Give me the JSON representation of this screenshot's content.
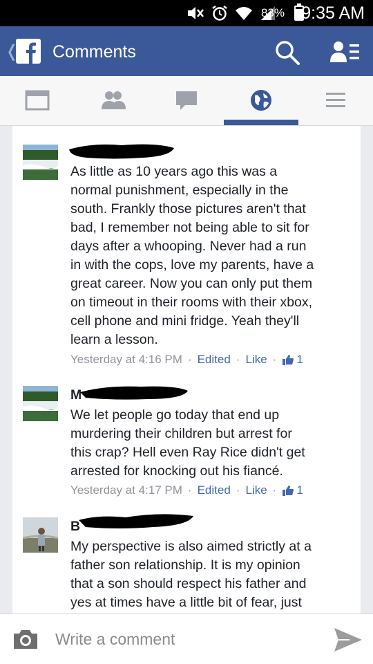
{
  "status_bar": {
    "battery_percent_label": "83%",
    "battery_level": 0.83,
    "time": "9:35 AM",
    "icons": [
      "mute-icon",
      "alarm-icon",
      "wifi-icon",
      "signal-icon",
      "battery-icon"
    ]
  },
  "app_bar": {
    "title": "Comments",
    "icons": [
      "back-chevron-icon",
      "facebook-logo-icon",
      "search-icon",
      "friends-icon"
    ]
  },
  "tabs": [
    {
      "name": "news-feed-icon",
      "active": false
    },
    {
      "name": "friend-requests-icon",
      "active": false
    },
    {
      "name": "messages-icon",
      "active": false
    },
    {
      "name": "notifications-globe-icon",
      "active": true
    },
    {
      "name": "menu-icon",
      "active": false
    }
  ],
  "comments": [
    {
      "author_visible": "",
      "text": "As little as 10 years ago this was a\nnormal punishment, especially in the\nsouth. Frankly those pictures aren't that\nbad, I remember not being able to sit for\ndays after a whooping. Never had a run\nin with the cops, love my parents, have a\ngreat career. Now you can only put them\non timeout in their rooms with their xbox,\ncell phone and mini fridge. Yeah they'll\nlearn a lesson.",
      "time": "Yesterday at 4:16 PM",
      "edited": "Edited",
      "like": "Like",
      "like_count": "1"
    },
    {
      "author_visible": "M",
      "text": "We let people go today that end up\nmurdering their children but arrest for\nthis crap? Hell even Ray Rice didn't get\narrested for knocking out his fiancé.",
      "time": "Yesterday at 4:17 PM",
      "edited": "Edited",
      "like": "Like",
      "like_count": "1"
    },
    {
      "author_visible": "B",
      "text": "My perspective is also aimed strictly at a\nfather son relationship.  It is my opinion\nthat a son should respect his father and\nyes at times have a little bit of fear, just",
      "time": "",
      "edited": "",
      "like": "",
      "like_count": ""
    }
  ],
  "composer": {
    "placeholder": "Write a comment",
    "icons": [
      "camera-icon",
      "send-icon"
    ]
  },
  "colors": {
    "brand": "#3b5998",
    "link": "#4267b2",
    "meta": "#90949c",
    "background": "#e9ebee"
  }
}
